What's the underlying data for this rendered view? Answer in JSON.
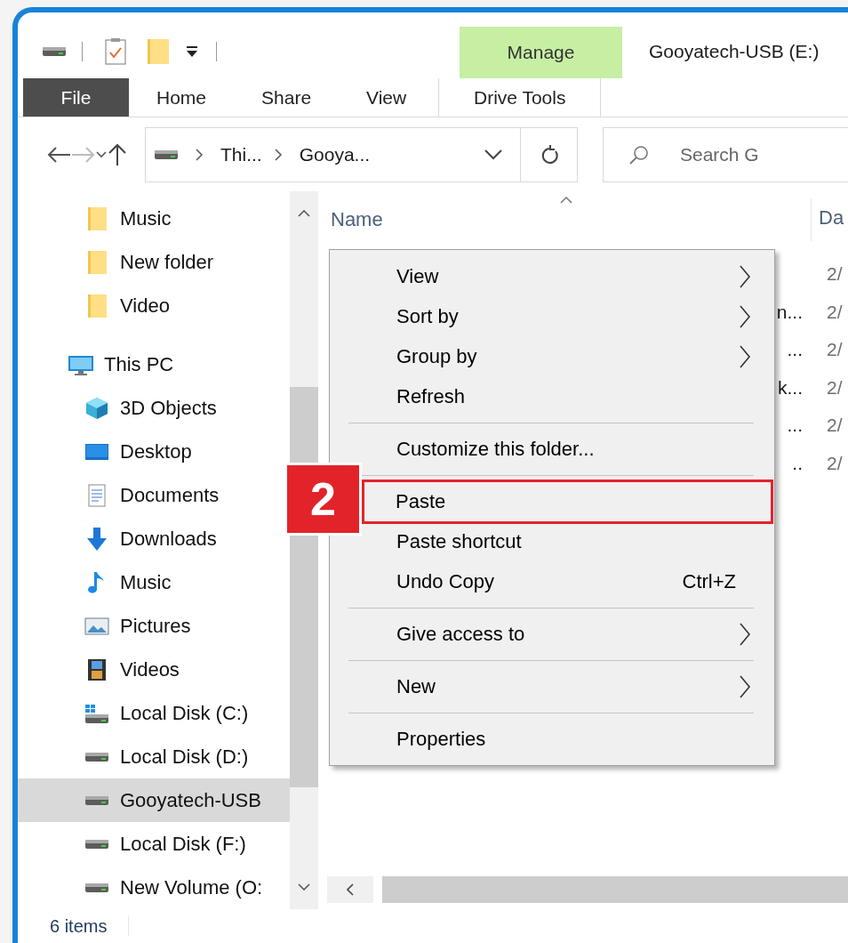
{
  "ribbon": {
    "contextual_group": "Manage",
    "title": "Gooyatech-USB (E:)",
    "tabs": [
      {
        "label": "File",
        "kind": "file",
        "selected": false
      },
      {
        "label": "Home",
        "kind": "tab",
        "selected": false
      },
      {
        "label": "Share",
        "kind": "tab",
        "selected": false
      },
      {
        "label": "View",
        "kind": "tab",
        "selected": false
      },
      {
        "label": "Drive Tools",
        "kind": "contextual",
        "selected": false
      }
    ]
  },
  "address_bar": {
    "segments": [
      "Thi...",
      "Gooya..."
    ]
  },
  "search": {
    "placeholder": "Search G"
  },
  "navigation_pane": {
    "items": [
      {
        "children": [
          {
            "label": "Music",
            "kind": "folder",
            "selected": false
          },
          {
            "label": "New folder",
            "kind": "folder",
            "selected": false
          },
          {
            "label": "Video",
            "kind": "folder",
            "selected": false
          }
        ]
      },
      {
        "label": "This PC",
        "kind": "pc",
        "selected": false,
        "children": [
          {
            "label": "3D Objects",
            "kind": "objects",
            "selected": false
          },
          {
            "label": "Desktop",
            "kind": "desktop",
            "selected": false
          },
          {
            "label": "Documents",
            "kind": "documents",
            "selected": false
          },
          {
            "label": "Downloads",
            "kind": "downloads",
            "selected": false
          },
          {
            "label": "Music",
            "kind": "music",
            "selected": false
          },
          {
            "label": "Pictures",
            "kind": "pictures",
            "selected": false
          },
          {
            "label": "Videos",
            "kind": "videos",
            "selected": false
          },
          {
            "label": "Local Disk (C:)",
            "kind": "windrive",
            "selected": false
          },
          {
            "label": "Local Disk (D:)",
            "kind": "drive",
            "selected": false
          },
          {
            "label": "Gooyatech-USB",
            "kind": "drive",
            "selected": true
          },
          {
            "label": "Local Disk (F:)",
            "kind": "drive",
            "selected": false
          },
          {
            "label": "New Volume (O:",
            "kind": "drive",
            "selected": false
          }
        ]
      }
    ]
  },
  "file_list": {
    "columns": [
      "Name",
      "Da"
    ],
    "rows": [
      {
        "date": "2/"
      },
      {
        "name": "n...",
        "date": "2/"
      },
      {
        "name": "...",
        "date": "2/"
      },
      {
        "name": "k...",
        "date": "2/"
      },
      {
        "name": "...",
        "date": "2/"
      },
      {
        "name": "..",
        "date": "2/"
      }
    ]
  },
  "context_menu": {
    "items": [
      {
        "kind": "item",
        "label": "View",
        "submenu": true,
        "highlighted": false
      },
      {
        "kind": "item",
        "label": "Sort by",
        "submenu": true,
        "highlighted": false
      },
      {
        "kind": "item",
        "label": "Group by",
        "submenu": true,
        "highlighted": false
      },
      {
        "kind": "item",
        "label": "Refresh",
        "submenu": false,
        "highlighted": false
      },
      {
        "kind": "separator"
      },
      {
        "kind": "item",
        "label": "Customize this folder...",
        "submenu": false,
        "highlighted": false
      },
      {
        "kind": "separator"
      },
      {
        "kind": "item",
        "label": "Paste",
        "submenu": false,
        "highlighted": true
      },
      {
        "kind": "item",
        "label": "Paste shortcut",
        "submenu": false,
        "highlighted": false
      },
      {
        "kind": "item",
        "label": "Undo Copy",
        "shortcut": "Ctrl+Z",
        "submenu": false,
        "highlighted": false
      },
      {
        "kind": "separator"
      },
      {
        "kind": "item",
        "label": "Give access to",
        "submenu": true,
        "highlighted": false
      },
      {
        "kind": "separator"
      },
      {
        "kind": "item",
        "label": "New",
        "submenu": true,
        "highlighted": false
      },
      {
        "kind": "separator"
      },
      {
        "kind": "item",
        "label": "Properties",
        "submenu": false,
        "highlighted": false
      }
    ]
  },
  "step_badge": {
    "label": "2"
  },
  "status_bar": {
    "item_count": "6 items"
  }
}
